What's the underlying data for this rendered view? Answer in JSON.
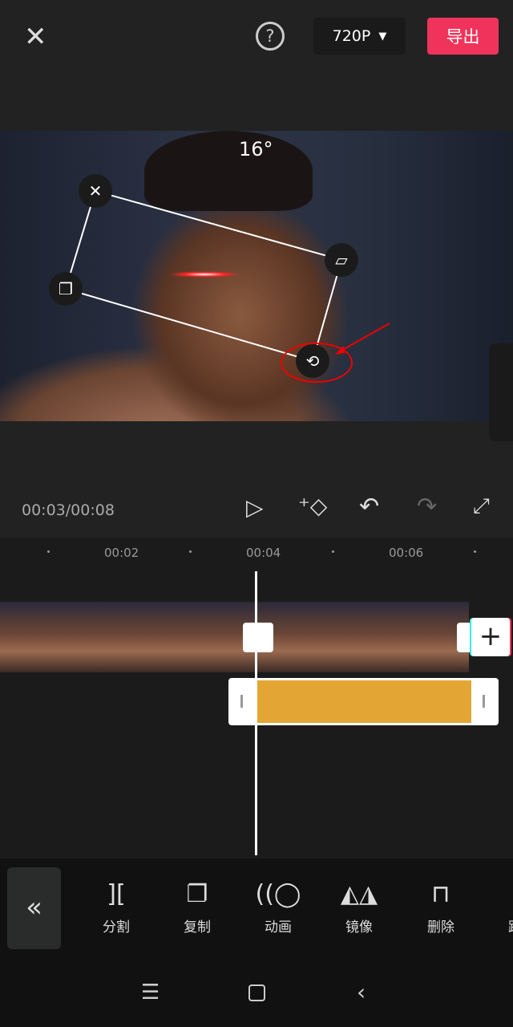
{
  "header": {
    "close_icon": "close-icon",
    "help_icon": "help-icon",
    "resolution": "720P",
    "export_label": "导出",
    "export_color": "#f0335a"
  },
  "preview": {
    "rotation_angle": "16°"
  },
  "controls": {
    "time": "00:03/00:08"
  },
  "timeline": {
    "ticks": [
      "00:02",
      "00:04",
      "00:06"
    ]
  },
  "toolbar": {
    "items": [
      {
        "label": "分割",
        "icon": "split-icon"
      },
      {
        "label": "复制",
        "icon": "copy-icon"
      },
      {
        "label": "动画",
        "icon": "animation-icon"
      },
      {
        "label": "镜像",
        "icon": "mirror-icon"
      },
      {
        "label": "删除",
        "icon": "delete-icon"
      },
      {
        "label": "跟踪",
        "icon": "track-icon"
      }
    ]
  }
}
